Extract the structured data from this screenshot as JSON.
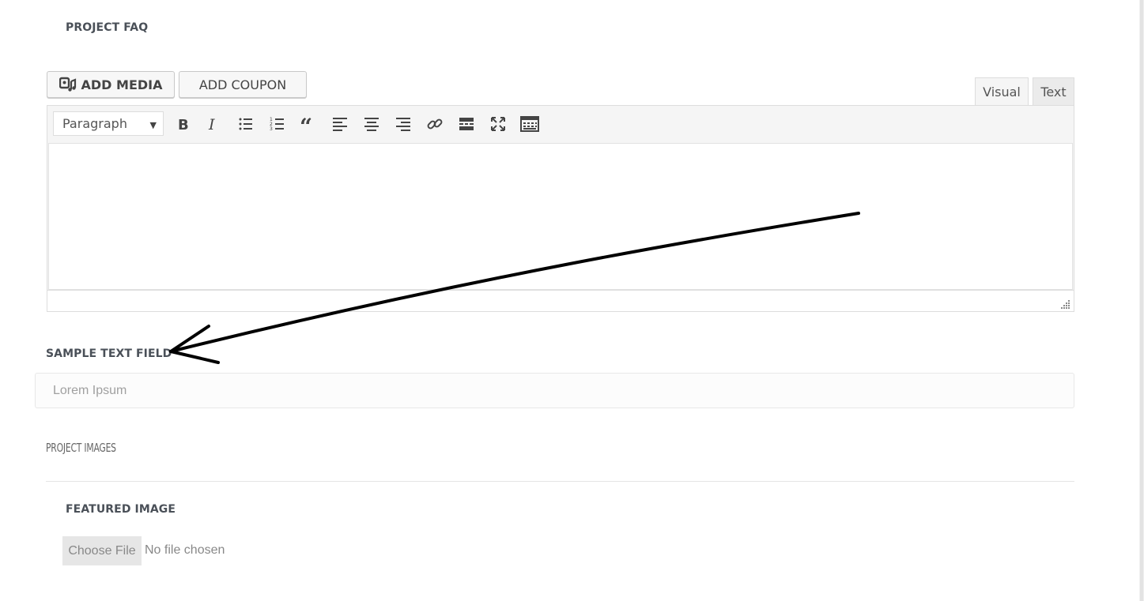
{
  "sections": {
    "project_faq": "PROJECT FAQ",
    "sample_text_field": "SAMPLE TEXT FIELD",
    "project_images": "PROJECT IMAGES",
    "featured_image": "FEATURED IMAGE"
  },
  "media_buttons": {
    "add_media": "ADD MEDIA",
    "add_coupon": "ADD COUPON"
  },
  "editor": {
    "tabs": {
      "visual": "Visual",
      "text": "Text"
    },
    "format_select": "Paragraph",
    "toolbar_icons": [
      "bold-icon",
      "italic-icon",
      "bullet-list-icon",
      "numbered-list-icon",
      "blockquote-icon",
      "align-left-icon",
      "align-center-icon",
      "align-right-icon",
      "link-icon",
      "read-more-icon",
      "fullscreen-icon",
      "toolbar-toggle-icon"
    ]
  },
  "sample_field": {
    "placeholder": "Lorem Ipsum",
    "value": ""
  },
  "file_input": {
    "button": "Choose File",
    "status": "No file chosen"
  },
  "colors": {
    "heading": "#4a5058",
    "toolbar_bg": "#f5f5f5",
    "arrow": "#000000"
  }
}
